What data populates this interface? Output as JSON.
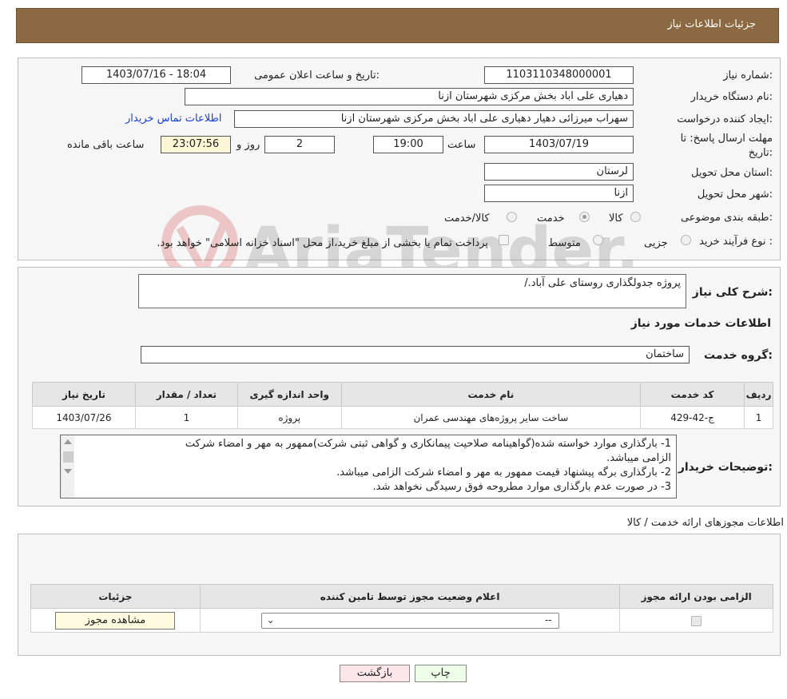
{
  "header": {
    "title": "جزئیات اطلاعات نیاز"
  },
  "fields": {
    "need_number_label": "شماره نیاز:",
    "need_number": "1103110348000001",
    "announce_label": "تاریخ و ساعت اعلان عمومی:",
    "announce_value": "1403/07/16 - 18:04",
    "buyer_org_label": "نام دستگاه خریدار:",
    "buyer_org": "دهیاری علی اباد بخش مرکزی شهرستان ازنا",
    "creator_label": "ایجاد کننده درخواست:",
    "creator": "سهراب میرزائی دهیار دهیاری علی اباد بخش مرکزی شهرستان ازنا",
    "contact_link": "اطلاعات تماس خریدار",
    "deadline_label_1": "مهلت ارسال پاسخ: تا",
    "deadline_label_2": "تاریخ:",
    "deadline_date": "1403/07/19",
    "time_label": "ساعت",
    "deadline_time": "19:00",
    "days_value": "2",
    "days_label": "روز و",
    "remaining_time": "23:07:56",
    "remaining_label": "ساعت باقی مانده",
    "province_label": "استان محل تحویل:",
    "province": "لرستان",
    "city_label": "شهر محل تحویل:",
    "city": "ازنا",
    "category_label": "طبقه بندی موضوعی:",
    "category_options": [
      "کالا",
      "خدمت",
      "کالا/خدمت"
    ],
    "category_selected": "خدمت",
    "process_label": "نوع فرآیند خرید :",
    "process_options": [
      "جزیی",
      "متوسط"
    ],
    "payment_note": "پرداخت تمام یا بخشی از مبلغ خرید،از محل \"اسناد خزانه اسلامی\" خواهد بود."
  },
  "summary": {
    "label": "شرح کلی نیاز:",
    "text": "پروژه جدولگذاری روستای علی آباد./"
  },
  "services": {
    "section_title": "اطلاعات خدمات مورد نیاز",
    "group_label": "گروه خدمت:",
    "group_value": "ساختمان",
    "columns": [
      "ردیف",
      "کد خدمت",
      "نام خدمت",
      "واحد اندازه گیری",
      "تعداد / مقدار",
      "تاریخ نیاز"
    ],
    "rows": [
      {
        "row": "1",
        "code": "ج-42-429",
        "name": "ساخت سایر پروژه‌های مهندسی عمران",
        "unit": "پروژه",
        "qty": "1",
        "date": "1403/07/26"
      }
    ]
  },
  "buyer_notes": {
    "label": "توضیحات خریدار:",
    "lines": [
      "1- بارگذاری موارد خواسته شده(گواهینامه صلاحیت پیمانکاری و گواهی ثبتی شرکت)ممهور به مهر و امضاء شرکت",
      "الزامی میباشد.",
      "2- بارگذاری برگه پیشنهاد قیمت ممهور به مهر و امضاء شرکت الزامی میباشد.",
      "3- در صورت عدم بارگذاری موارد مطروحه فوق رسیدگی نخواهد شد."
    ]
  },
  "permits": {
    "section_title": "اطلاعات مجوزهای ارائه خدمت / کالا",
    "columns": [
      "الزامی بودن ارائه مجوز",
      "اعلام وضعیت مجوز توسط تامین کننده",
      "جزئیات"
    ],
    "select_value": "--",
    "view_button": "مشاهده مجوز"
  },
  "buttons": {
    "print": "چاپ",
    "back": "بازگشت"
  },
  "watermark": {
    "text": "AriaTender.neT"
  }
}
